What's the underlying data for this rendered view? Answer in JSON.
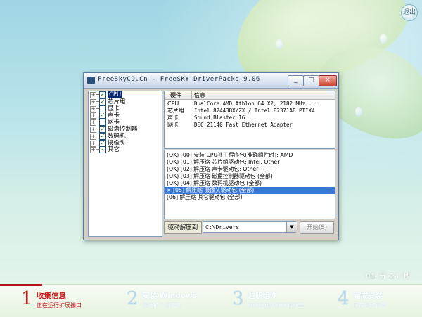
{
  "window": {
    "title": "FreeSkyCD.Cn - FreeSKY DriverPacks 9.06",
    "min_glyph": "_",
    "max_glyph": "□",
    "close_glyph": "×"
  },
  "corner_button": "退出",
  "tree": [
    {
      "label": "CPU",
      "checked": true,
      "selected": true
    },
    {
      "label": "芯片组",
      "checked": true,
      "selected": false
    },
    {
      "label": "显卡",
      "checked": false,
      "selected": false
    },
    {
      "label": "声卡",
      "checked": true,
      "selected": false
    },
    {
      "label": "网卡",
      "checked": false,
      "selected": false
    },
    {
      "label": "磁盘控制器",
      "checked": true,
      "selected": false
    },
    {
      "label": "数码机",
      "checked": true,
      "selected": false
    },
    {
      "label": "摄像头",
      "checked": true,
      "selected": false
    },
    {
      "label": "其它",
      "checked": true,
      "selected": false
    }
  ],
  "info": {
    "col1": "硬件",
    "col2": "信息",
    "rows": [
      {
        "k": "CPU",
        "v": "DualCore AMD Athlon 64 X2, 2182 MHz ..."
      },
      {
        "k": "芯片组",
        "v": "Intel 82443BX/ZX / Intel 82371AB PIIX4"
      },
      {
        "k": "声卡",
        "v": "Sound Blaster 16"
      },
      {
        "k": "网卡",
        "v": "DEC 21140 Fast Ethernet Adapter"
      }
    ]
  },
  "log": [
    {
      "text": "(OK) [00] 安装 CPU补丁程序包(准确组件时): AMD",
      "selected": false
    },
    {
      "text": "(OK) [01] 解压缩 芯片组驱动包: Intel, Other",
      "selected": false
    },
    {
      "text": "(OK) [02] 解压缩 声卡驱动包: Other",
      "selected": false
    },
    {
      "text": "(OK) [03] 解压缩 磁盘控制器驱动包 (全部)",
      "selected": false
    },
    {
      "text": "(OK) [04] 解压缩 数码机驱动包 (全部)",
      "selected": false
    },
    {
      "text": "> [05] 解压缩 摄像头驱动包 (全部)",
      "selected": true
    },
    {
      "text": "[06] 解压缩 其它驱动包 (全部)",
      "selected": false
    }
  ],
  "unpack": {
    "label": "驱动解压到",
    "path": "C:\\Drivers",
    "dropdown_glyph": "▼",
    "start": "开始(S)"
  },
  "timer": "01 分 24 秒",
  "steps": [
    {
      "num": "1",
      "title": "收集信息",
      "sub": "正在运行扩展接口",
      "active": true
    },
    {
      "num": "2",
      "title": "安装 Windows",
      "sub": "运行前 / 后安装",
      "active": false
    },
    {
      "num": "3",
      "title": "注册组件",
      "sub": "组件注册的组件和服务",
      "active": false
    },
    {
      "num": "4",
      "title": "完成安装",
      "sub": "保存系统设置",
      "active": false
    }
  ],
  "colors": {
    "accent": "#c21818",
    "selection": "#3a78d6"
  }
}
